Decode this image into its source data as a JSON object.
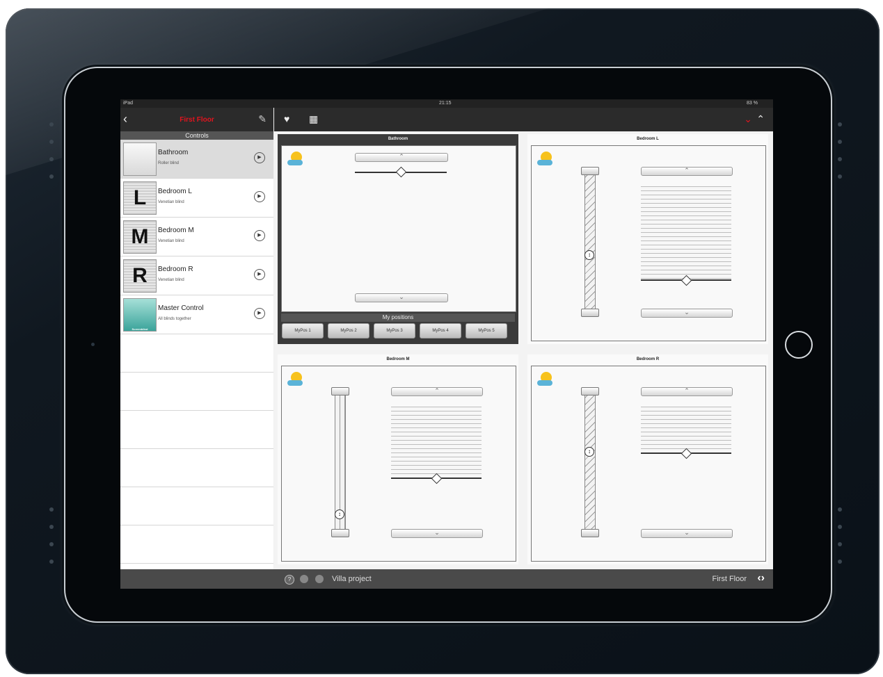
{
  "statusbar": {
    "carrier": "iPad",
    "time": "21:15",
    "battery": "83 %"
  },
  "left_header": {
    "title": "First Floor",
    "section": "Controls"
  },
  "list": [
    {
      "name": "Bathroom",
      "sub": "Roller blind",
      "thumb": ""
    },
    {
      "name": "Bedroom L",
      "sub": "Venetian blind",
      "thumb": "L"
    },
    {
      "name": "Bedroom M",
      "sub": "Venetian blind",
      "thumb": "M"
    },
    {
      "name": "Bedroom R",
      "sub": "Venetian blind",
      "thumb": "R"
    },
    {
      "name": "Master Control",
      "sub": "All blinds together",
      "thumb": "Screenblind"
    }
  ],
  "panels": {
    "bathroom": {
      "title": "Bathroom"
    },
    "bedroom_l": {
      "title": "Bedroom L"
    },
    "bedroom_m": {
      "title": "Bedroom M"
    },
    "bedroom_r": {
      "title": "Bedroom R"
    }
  },
  "my_positions": {
    "label": "My positions",
    "items": [
      "MyPos 1",
      "MyPos 2",
      "MyPos 3",
      "MyPos 4",
      "MyPos 5"
    ]
  },
  "bottom": {
    "project": "Villa project",
    "floor": "First Floor"
  },
  "colors": {
    "accent": "#e1141e",
    "bar": "#2b2b2b"
  }
}
